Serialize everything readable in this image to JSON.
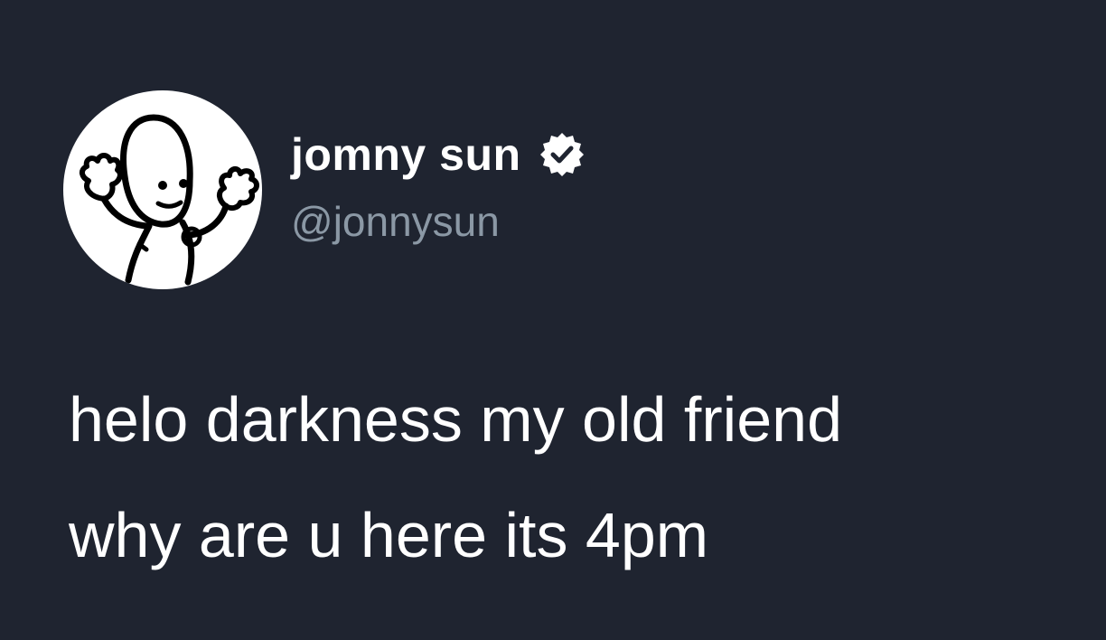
{
  "tweet": {
    "author": {
      "display_name": "jomny sun",
      "handle": "@jonnysun",
      "verified": true,
      "avatar_icon": "cartoon-character-avatar-icon"
    },
    "text_lines": [
      "helo darkness my old friend",
      "why are u here its 4pm"
    ]
  },
  "colors": {
    "background": "#1f2430",
    "name": "#ffffff",
    "handle": "#8b98a5",
    "text": "#ffffff",
    "verified_badge": "#ffffff"
  }
}
